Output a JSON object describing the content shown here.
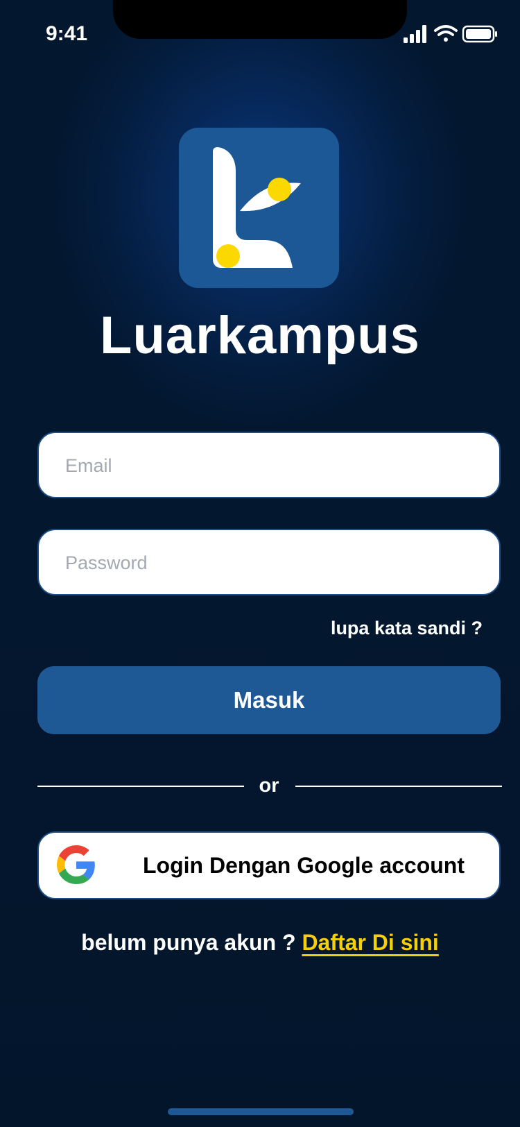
{
  "status_bar": {
    "time": "9:41",
    "icons": [
      "signal-icon",
      "wifi-icon",
      "battery-icon"
    ]
  },
  "brand": {
    "app_name": "Luarkampus",
    "logo": "luarkampus-logo",
    "colors": {
      "logo_bg": "#1c5896",
      "accent_yellow": "#f6cf0b",
      "primary_button": "#1f5995",
      "background": "#03172f"
    }
  },
  "form": {
    "email_placeholder": "Email",
    "email_value": "",
    "password_placeholder": "Password",
    "password_value": "",
    "forgot_label": "lupa kata sandi ?",
    "submit_label": "Masuk"
  },
  "divider": {
    "label": "or"
  },
  "google": {
    "label": "Login Dengan Google account",
    "icon": "google-icon"
  },
  "signup": {
    "prompt": "belum punya akun ?",
    "link_label": "Daftar Di sini"
  }
}
